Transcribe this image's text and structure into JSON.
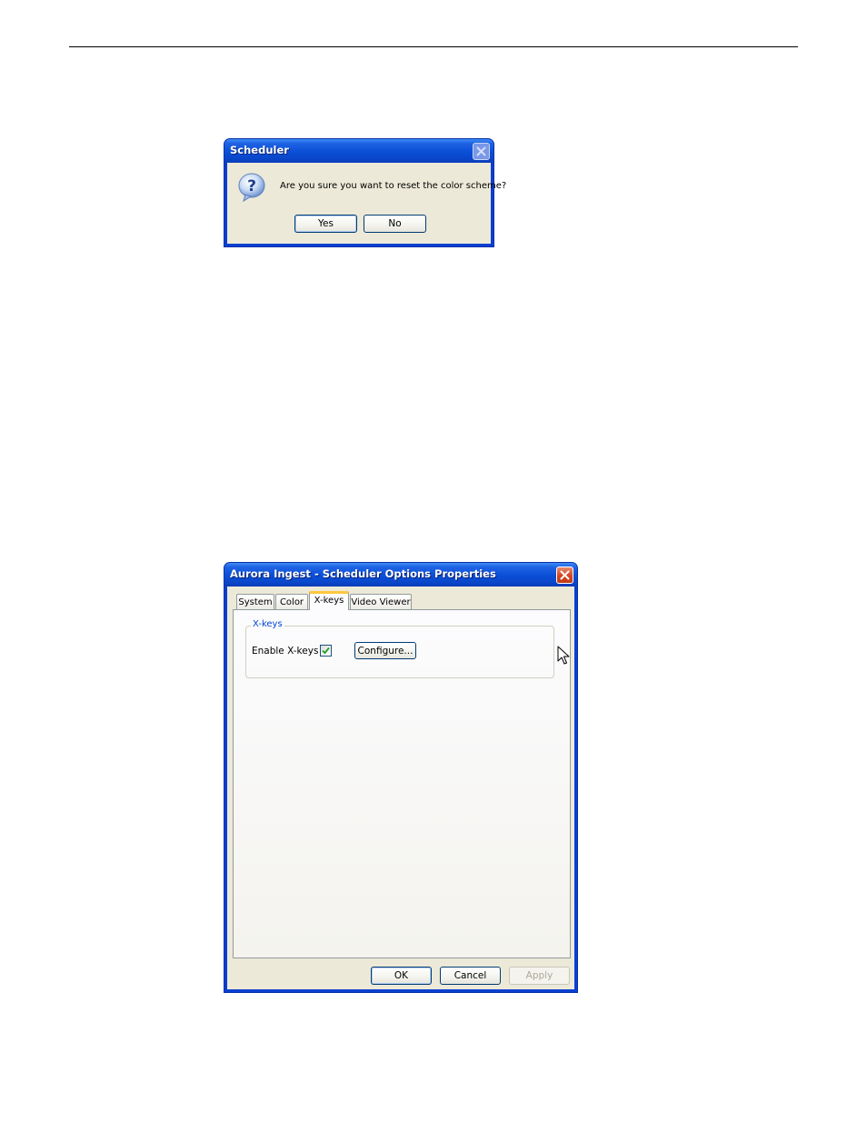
{
  "dialog1": {
    "title": "Scheduler",
    "message": "Are you sure you want to reset the color scheme?",
    "yes_label": "Yes",
    "no_label": "No",
    "icon": "question-icon",
    "close_state": "disabled"
  },
  "dialog2": {
    "title": "Aurora Ingest - Scheduler Options Properties",
    "tabs": [
      {
        "label": "System",
        "selected": false
      },
      {
        "label": "Color",
        "selected": false
      },
      {
        "label": "X-keys",
        "selected": true
      },
      {
        "label": "Video Viewer",
        "selected": false
      }
    ],
    "group_title": "X-keys",
    "enable_label": "Enable X-keys",
    "enable_checked": true,
    "configure_label": "Configure...",
    "ok_label": "OK",
    "cancel_label": "Cancel",
    "apply_label": "Apply",
    "apply_enabled": false
  },
  "colors": {
    "xp_title_blue": "#0a4ed6",
    "dialog_face": "#ece9d8",
    "tab_highlight": "#ffc83c",
    "group_title": "#0046d5",
    "close_red": "#d34621"
  }
}
